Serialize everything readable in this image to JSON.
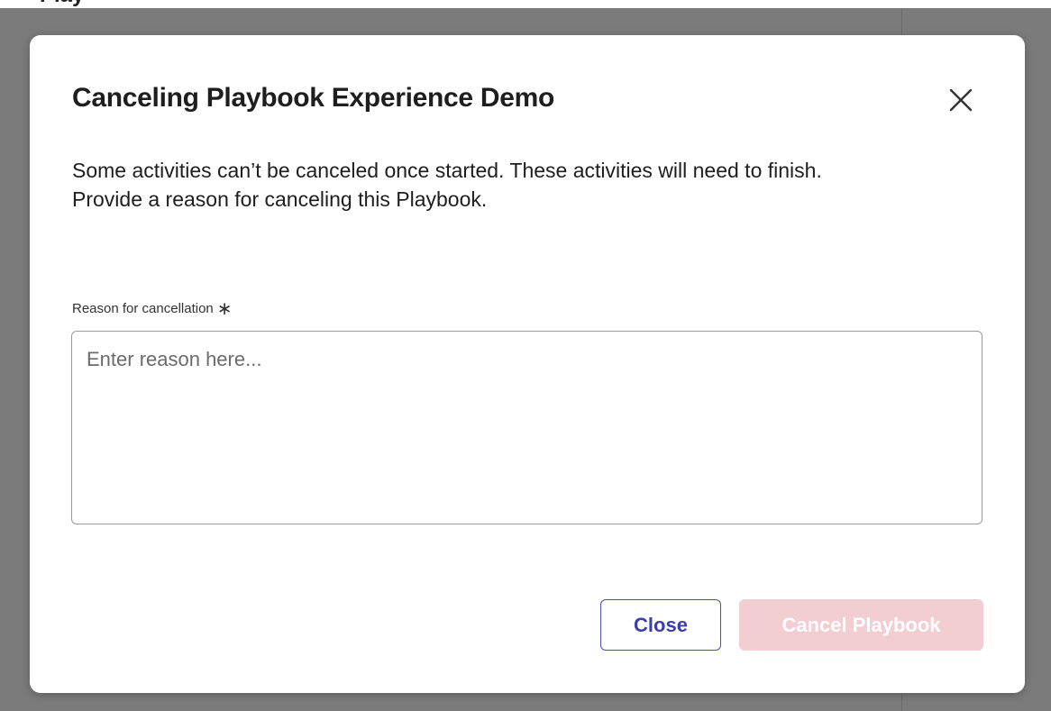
{
  "background": {
    "partial_heading": "Play"
  },
  "modal": {
    "title": "Canceling Playbook Experience Demo",
    "description_line1": "Some activities can’t be canceled once started. These activities will need to finish.",
    "description_line2": "Provide a reason for canceling this Playbook.",
    "field_label": "Reason for cancellation",
    "required_mark": "∗",
    "textarea_value": "",
    "textarea_placeholder": "Enter reason here...",
    "close_button_label": "Close",
    "cancel_button_label": "Cancel Playbook",
    "cancel_button_disabled": true,
    "icons": {
      "dismiss": "close-icon"
    },
    "colors": {
      "primary": "#4a4fb3",
      "danger_disabled": "#f2cdd1",
      "overlay": "#7b7b7b"
    }
  }
}
